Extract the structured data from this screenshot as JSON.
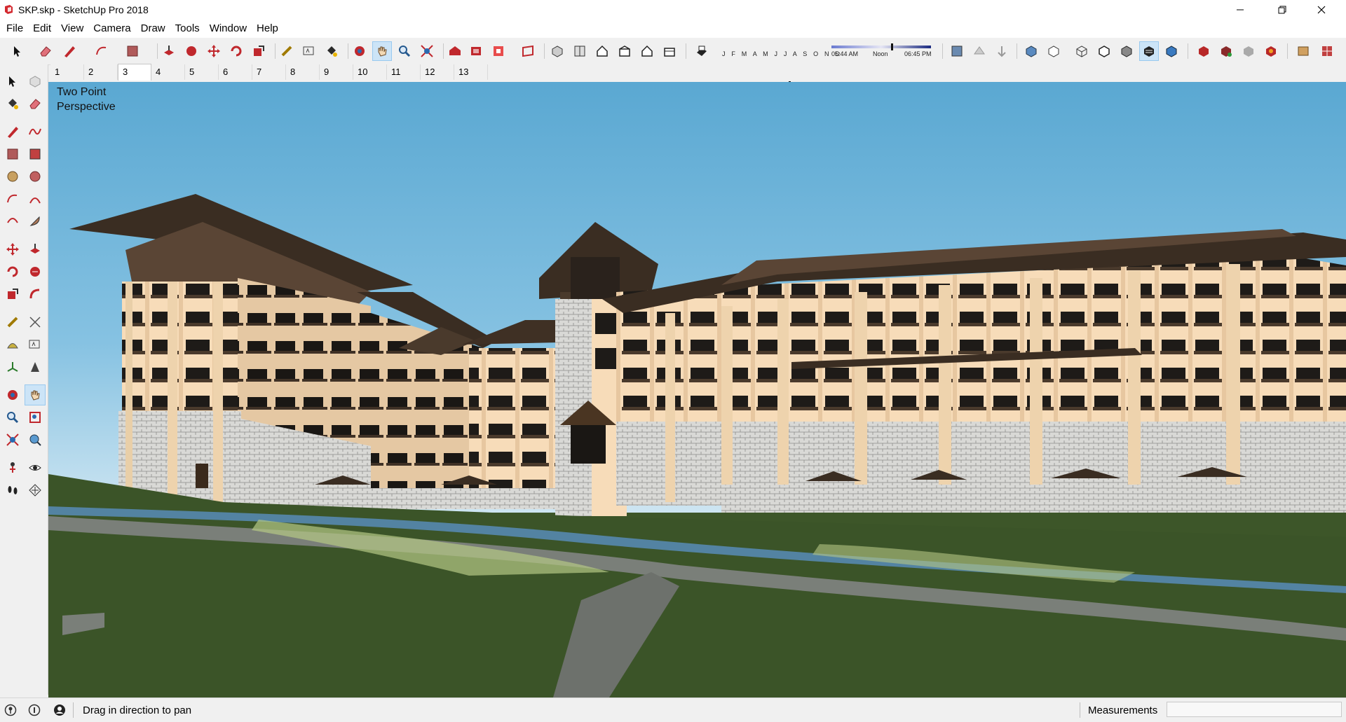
{
  "window": {
    "title": "SKP.skp - SketchUp Pro 2018",
    "controls": {
      "minimize_icon": "minimize-icon",
      "maximize_icon": "restore-icon",
      "close_icon": "close-icon"
    }
  },
  "menu": {
    "items": [
      "File",
      "Edit",
      "View",
      "Camera",
      "Draw",
      "Tools",
      "Window",
      "Help"
    ]
  },
  "toolbar": {
    "shadow_months": "J F M A M J J A S O N D",
    "time_start": "05:44 AM",
    "time_mid": "Noon",
    "time_end": "06:45 PM"
  },
  "scenes": {
    "tabs": [
      "1",
      "2",
      "3",
      "4",
      "5",
      "6",
      "7",
      "8",
      "9",
      "10",
      "11",
      "12",
      "13"
    ],
    "active_index": 2
  },
  "viewport": {
    "camera_label": "Two Point\nPerspective",
    "sky_color": "#5aa8d2",
    "grass_color": "#3a5427"
  },
  "statusbar": {
    "message": "Drag in direction to pan",
    "measurements_label": "Measurements",
    "measurements_value": ""
  },
  "colors": {
    "accent_active": "#cce4f7",
    "sketchup_red": "#c0282d"
  }
}
